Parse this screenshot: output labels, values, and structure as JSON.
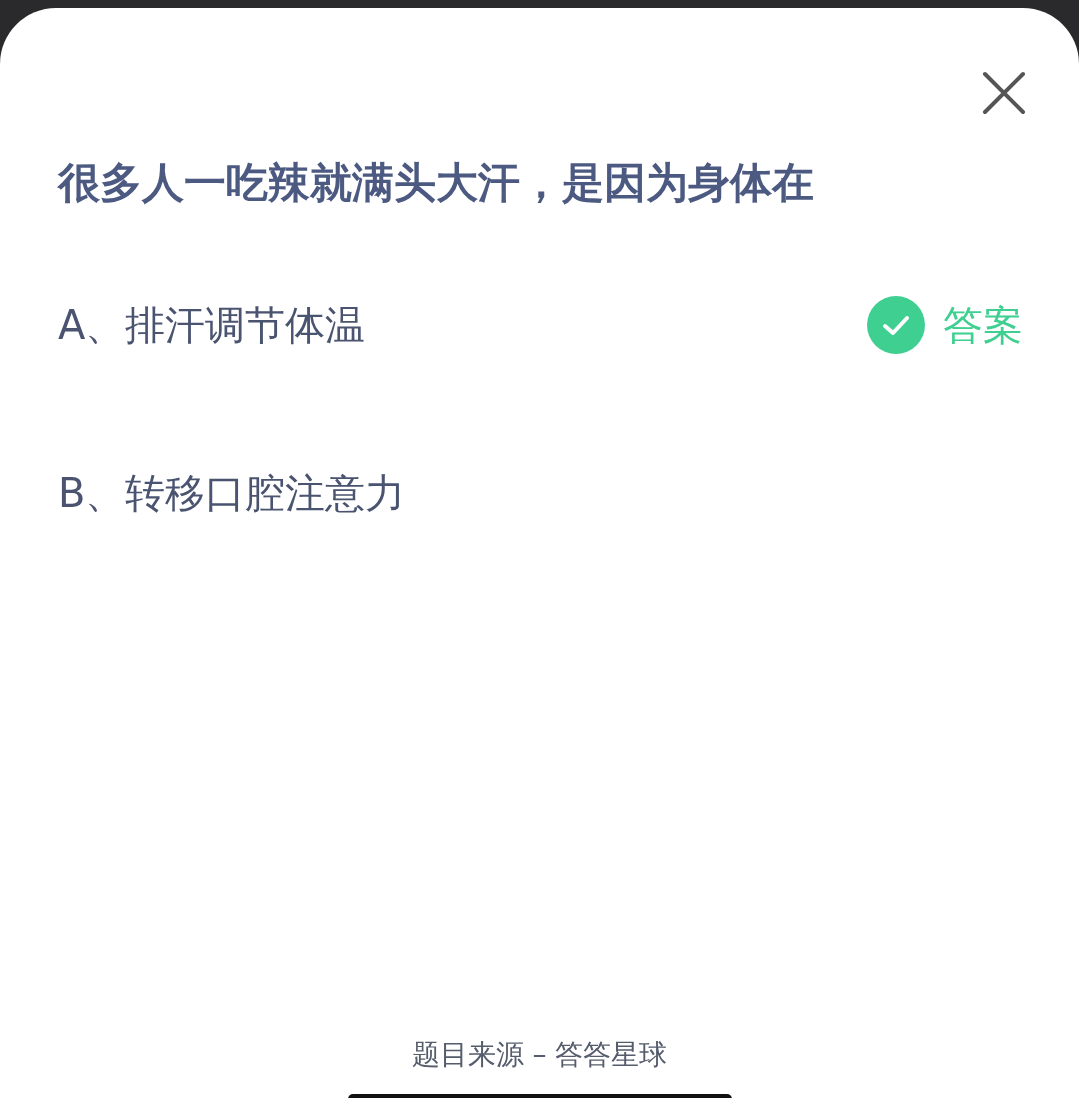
{
  "question": {
    "title": "很多人一吃辣就满头大汗，是因为身体在"
  },
  "options": [
    {
      "label": "A、排汗调节体温",
      "correct": true
    },
    {
      "label": "B、转移口腔注意力",
      "correct": false
    }
  ],
  "answer_label": "答案",
  "footer": "题目来源 – 答答星球"
}
